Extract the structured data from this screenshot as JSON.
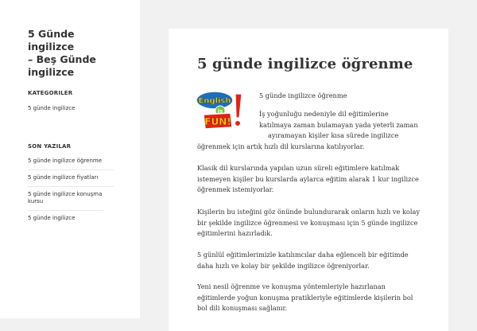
{
  "site": {
    "title_line1": "5 Günde ingilizce",
    "title_line2": "– Beş Günde",
    "title_line3": "ingilizce"
  },
  "sidebar": {
    "categories_title": "KATEGORILER",
    "categories": [
      "5 günde ingilizce"
    ],
    "recent_title": "SON YAZILAR",
    "recent_posts": [
      "5 günde ingilizce öğrenme",
      "5 günde ingilizce fiyatları",
      "5 günde ingilizce konuşma kursu",
      "5 günde ingilizce"
    ]
  },
  "post": {
    "title": "5 günde ingilizce öğrenme",
    "logo_alt": "English is FUN!",
    "logo_text_top": "English",
    "logo_text_mid": "is",
    "logo_text_bottom": "FUN!",
    "intro": "5 günde ingilizce öğrenme",
    "p1_l1": "İş yoğunluğu nedeniyle dil eğitimlerine",
    "p1_l2": "katılmaya zaman bulamayan yada yeterli zaman",
    "p1_l3": "ayıramayan kişiler kısa sürede ingilizce",
    "p1_l4": "öğrenmek için artık hızlı dil kurslarına katılıyorlar.",
    "p2_l1": "Klasik dil kurslarında yapılan uzun süreli eğitimlere katılmak",
    "p2_l2": "istemeyen kişiler bu kurslarda aylarca eğitim alarak 1 kur ingilizce",
    "p2_l3": "öğrenmek istemiyorlar.",
    "p3_l1": "Kişilerin bu isteğini göz önünde bulundurarak onların hızlı ve kolay",
    "p3_l2": "bir şekilde ingilizce öğrenmesi ve konuşması için 5 günde ingilizce",
    "p3_l3": "eğitimlerini hazırladık.",
    "p4_l1": "5 günlül eğitimlerimizle katılımcılar daha eğlenceli bir eğitimde",
    "p4_l2": "daha hızlı ve kolay bir şekilde ingilizce öğreniyorlar.",
    "p5_l1": "Yeni nesil öğrenme ve konuşma yöntemleriyle hazırlanan",
    "p5_l2": "eğitimlerde yoğun konuşma pratikleriyle eğitimlerde kişilerin bol",
    "p5_l3": "bol dili konuşması sağlanır."
  },
  "colors": {
    "background": "#f1f1f1",
    "panel": "#ffffff",
    "text": "#333333",
    "logo_green": "#7ac143",
    "logo_blue": "#1e6fb8",
    "logo_red": "#e2231a",
    "logo_yellow": "#ffd200"
  }
}
